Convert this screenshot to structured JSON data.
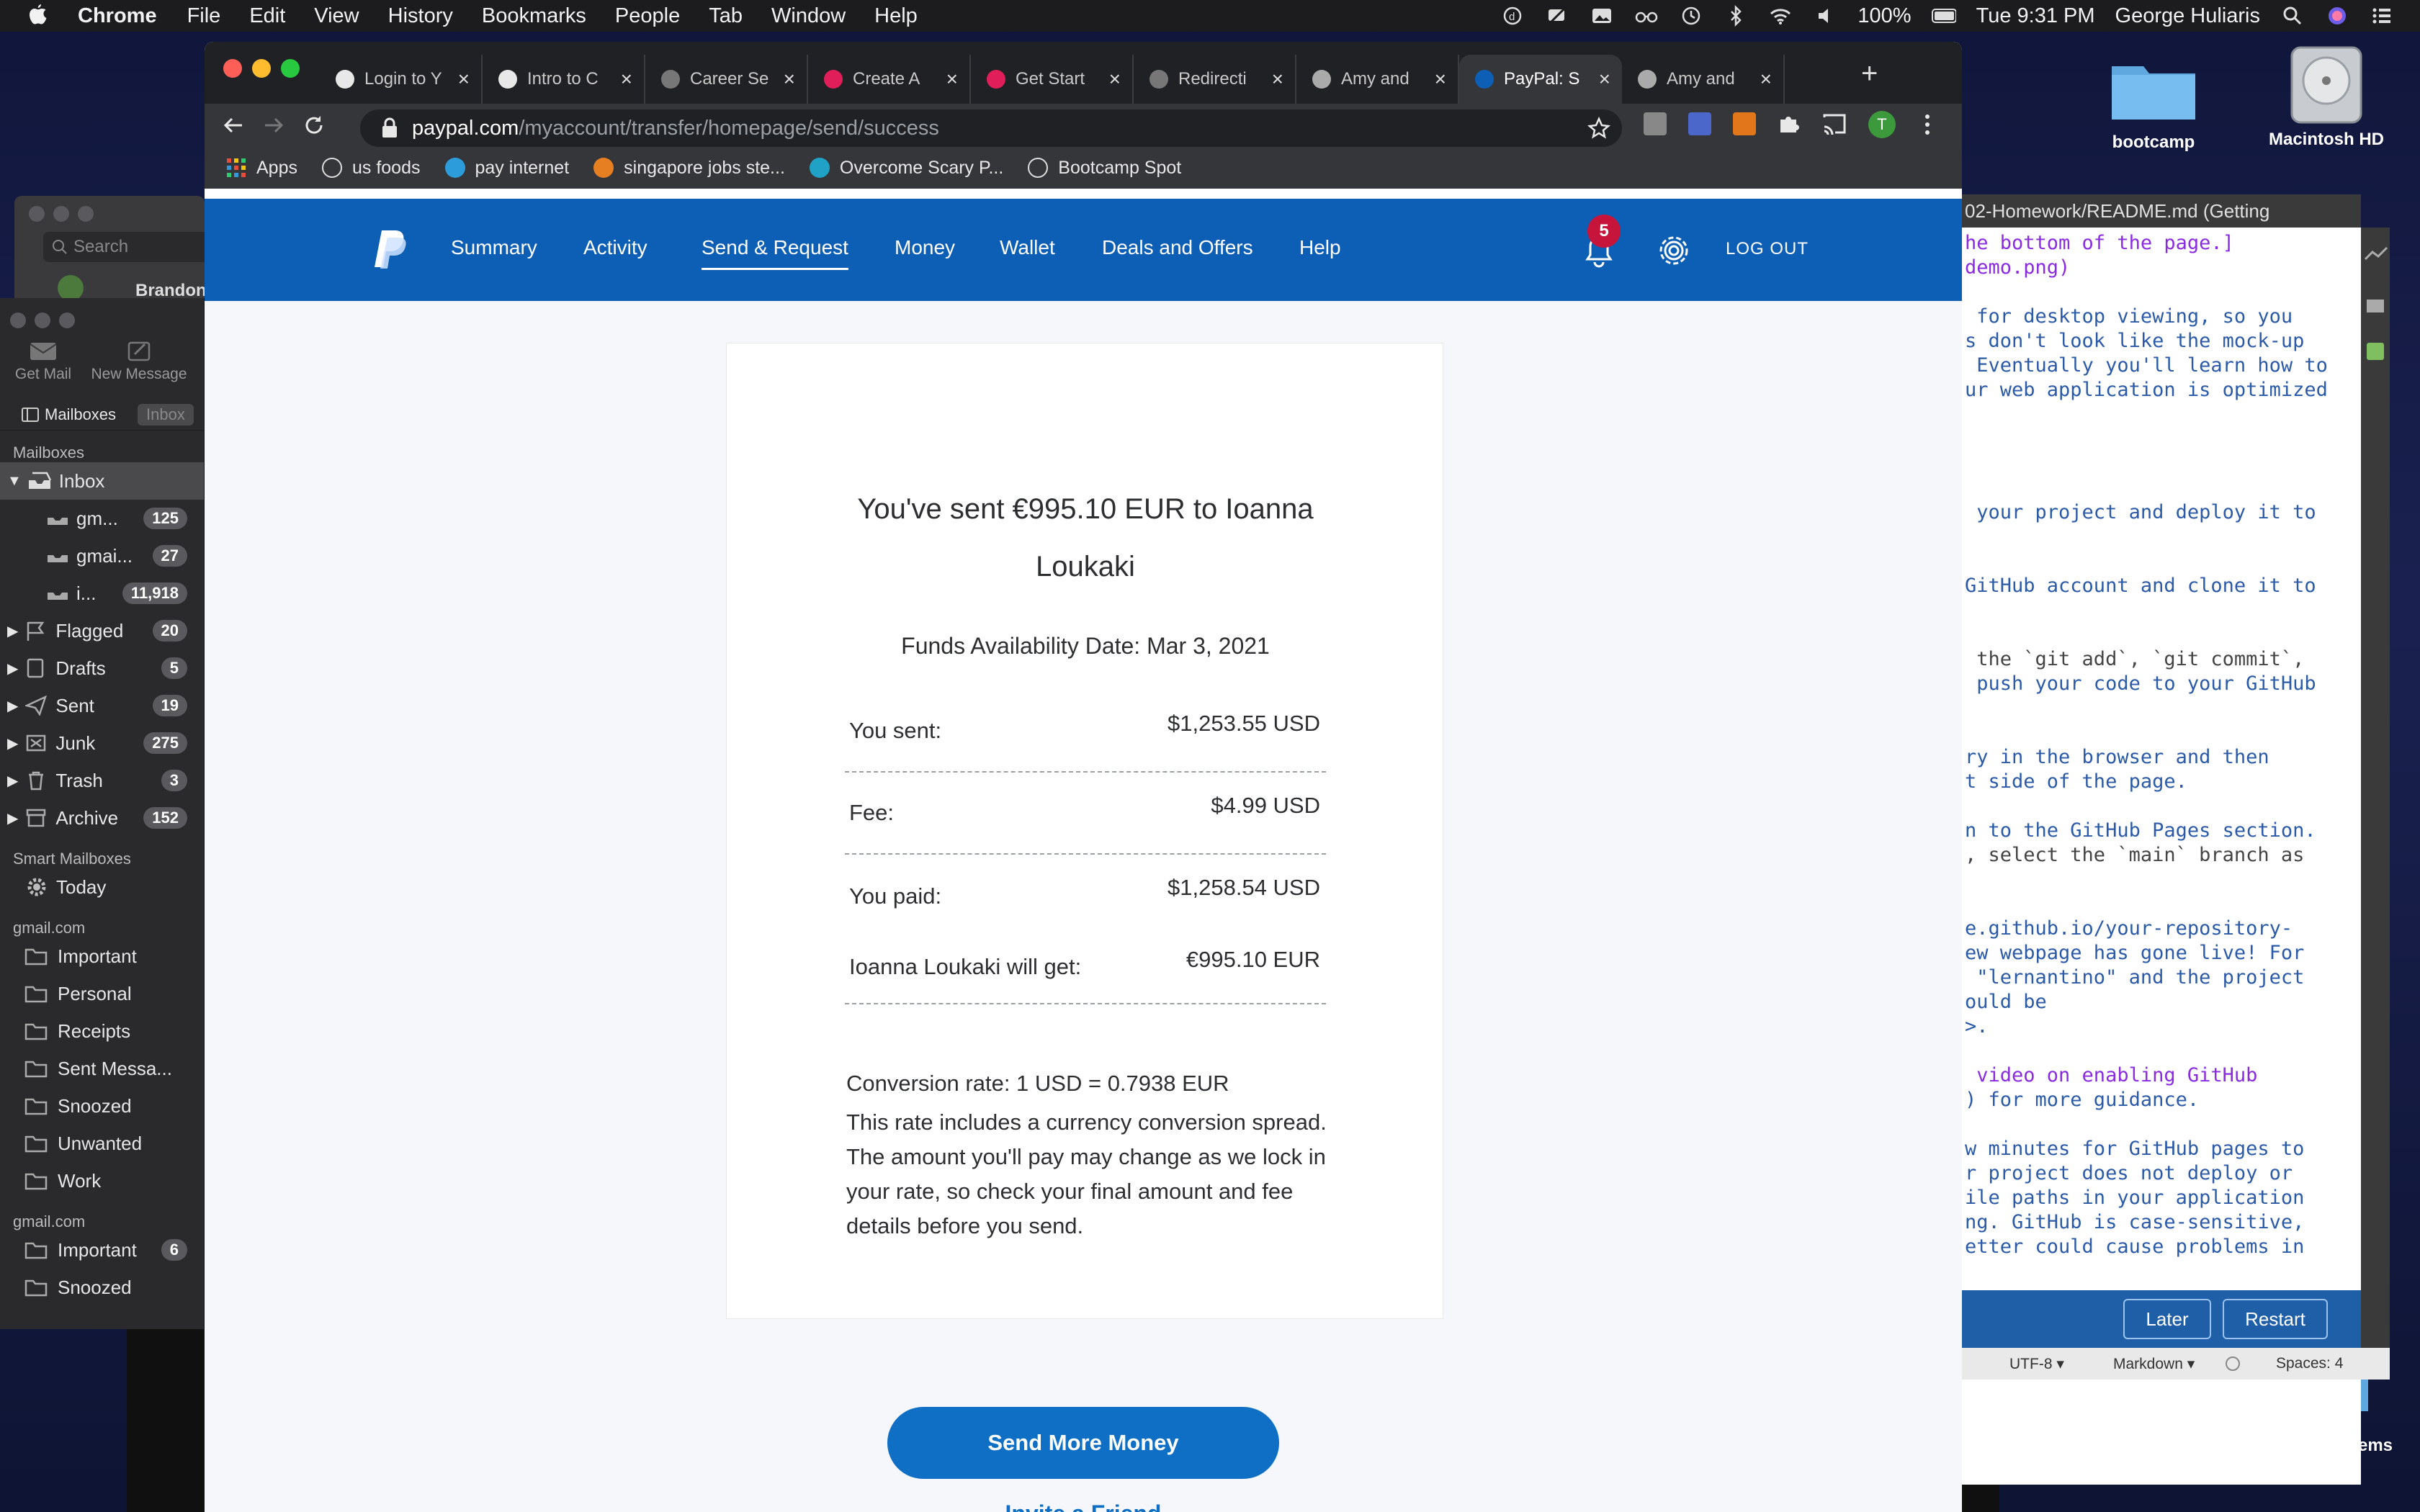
{
  "menubar": {
    "app_name": "Chrome",
    "items": [
      "File",
      "Edit",
      "View",
      "History",
      "Bookmarks",
      "People",
      "Tab",
      "Window",
      "Help"
    ],
    "battery": "100%",
    "datetime": "Tue 9:31 PM",
    "user": "George Huliaris"
  },
  "desktop": {
    "folder_label": "bootcamp",
    "disk_label": "Macintosh HD",
    "relocated_label": "Relocated Items"
  },
  "mail": {
    "search_placeholder": "Search",
    "partial_name": "Brandon",
    "toolbar": {
      "get_mail": "Get Mail",
      "new_message": "New Message"
    },
    "tabs": {
      "mailboxes": "Mailboxes",
      "inbox": "Inbox"
    },
    "section_mailboxes": "Mailboxes",
    "inbox": {
      "label": "Inbox"
    },
    "inbox_accounts": [
      {
        "label": "gm...",
        "count": "125"
      },
      {
        "label": "gmai...",
        "count": "27"
      },
      {
        "label": "i...",
        "count": "11,918"
      }
    ],
    "folders": [
      {
        "label": "Flagged",
        "count": "20"
      },
      {
        "label": "Drafts",
        "count": "5"
      },
      {
        "label": "Sent",
        "count": "19"
      },
      {
        "label": "Junk",
        "count": "275"
      },
      {
        "label": "Trash",
        "count": "3"
      },
      {
        "label": "Archive",
        "count": "152"
      }
    ],
    "section_smart": "Smart Mailboxes",
    "smart_today": "Today",
    "section_gmail_1": "gmail.com",
    "gmail_folders": [
      "Important",
      "Personal",
      "Receipts",
      "Sent Messa...",
      "Snoozed",
      "Unwanted",
      "Work"
    ],
    "section_gmail_2": "gmail.com",
    "gmail2_folders": [
      {
        "label": "Important",
        "count": "6"
      },
      {
        "label": "Snoozed",
        "count": ""
      }
    ]
  },
  "chrome": {
    "tabs": [
      {
        "label": "Login to Y",
        "active": false
      },
      {
        "label": "Intro to C",
        "active": false
      },
      {
        "label": "Career Se",
        "active": false
      },
      {
        "label": "Create A",
        "active": false
      },
      {
        "label": "Get Start",
        "active": false
      },
      {
        "label": "Redirecti",
        "active": false
      },
      {
        "label": "Amy and",
        "active": false
      },
      {
        "label": "PayPal: S",
        "active": true
      },
      {
        "label": "Amy and",
        "active": false
      }
    ],
    "url_domain": "paypal.com",
    "url_path": "/myaccount/transfer/homepage/send/success",
    "profile_initial": "T",
    "bookmarks": [
      "Apps",
      "us foods",
      "pay internet",
      "singapore jobs ste...",
      "Overcome Scary P...",
      "Bootcamp Spot"
    ]
  },
  "paypal": {
    "nav": [
      "Summary",
      "Activity",
      "Send & Request",
      "Money",
      "Wallet",
      "Deals and Offers",
      "Help"
    ],
    "active_nav": "Send & Request",
    "notifications_count": "5",
    "logout": "LOG OUT",
    "headline_line1": "You've sent €995.10 EUR to Ioanna",
    "headline_line2": "Loukaki",
    "funds_date": "Funds Availability Date: Mar 3, 2021",
    "rows": {
      "sent_label": "You sent:",
      "sent_value": "$1,253.55 USD",
      "fee_label": "Fee:",
      "fee_value": "$4.99 USD",
      "paid_label": "You paid:",
      "paid_value": "$1,258.54 USD",
      "gets_label": "Ioanna Loukaki will get:",
      "gets_value": "€995.10 EUR"
    },
    "conversion": "Conversion rate: 1 USD = 0.7938 EUR",
    "disclaimer": "This rate includes a currency conversion spread. The amount you'll pay may change as we lock in your rate, so check your final amount and fee details before you send.",
    "send_more": "Send More Money",
    "invite": "Invite a Friend",
    "brand_color": "#0d5fb6"
  },
  "editor": {
    "title": "02-Homework/README.md (Getting",
    "lines": [
      "he bottom of the page.]",
      "demo.png)",
      "",
      " for desktop viewing, so you",
      "s don't look like the mock-up",
      " Eventually you'll learn how to",
      "ur web application is optimized",
      "",
      "",
      "",
      "",
      " your project and deploy it to",
      "",
      "",
      "GitHub account and clone it to",
      "",
      "",
      " the `git add`, `git commit`,",
      " push your code to your GitHub",
      "",
      "",
      "ry in the browser and then",
      "t side of the page.",
      "",
      "n to the GitHub Pages section.",
      ", select the `main` branch as",
      "",
      "",
      "e.github.io/your-repository-",
      "ew webpage has gone live! For",
      " \"lernantino\" and the project",
      "ould be",
      ">.",
      "",
      " video on enabling GitHub",
      ") for more guidance.",
      "",
      "w minutes for GitHub pages to",
      "r project does not deploy or",
      "ile paths in your application",
      "ng. GitHub is case-sensitive,",
      "etter could cause problems in"
    ],
    "update": {
      "later": "Later",
      "restart": "Restart"
    },
    "status": {
      "encoding": "UTF-8",
      "grammar": "Markdown",
      "spaces": "Spaces: 4"
    }
  }
}
